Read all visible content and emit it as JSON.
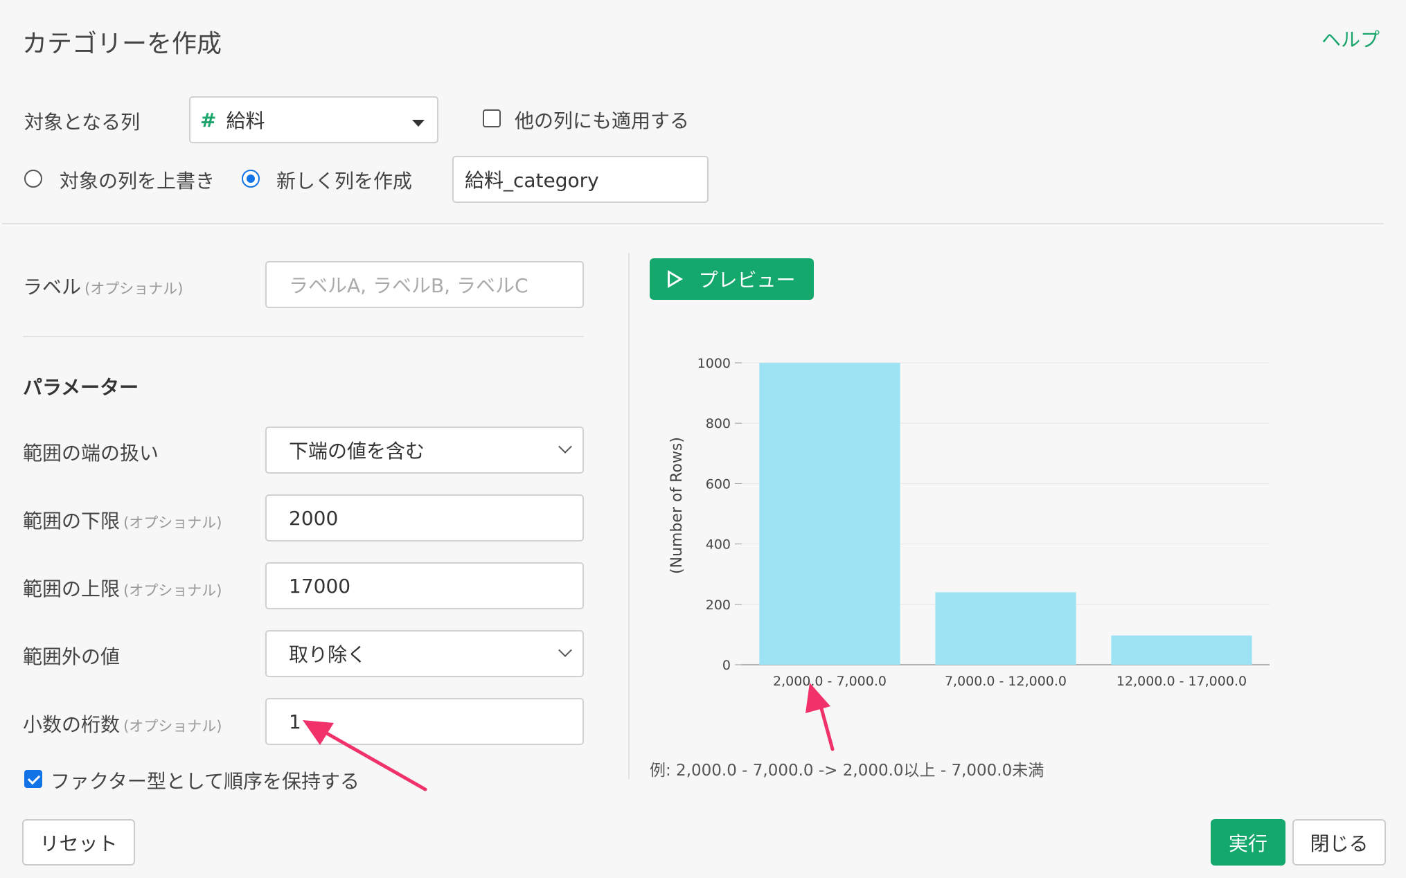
{
  "header": {
    "title": "カテゴリーを作成",
    "help_label": "ヘルプ"
  },
  "target": {
    "label": "対象となる列",
    "column": "給料",
    "column_type_icon": "#",
    "apply_others_label": "他の列にも適用する",
    "apply_others_checked": false
  },
  "mode": {
    "overwrite_label": "対象の列を上書き",
    "new_label": "新しく列を作成",
    "selected": "new",
    "new_column_name": "給料_category"
  },
  "label_field": {
    "label": "ラベル",
    "optional": "(オプショナル)",
    "placeholder": "ラベルA, ラベルB, ラベルC"
  },
  "params": {
    "heading": "パラメーター",
    "edge": {
      "label": "範囲の端の扱い",
      "value": "下端の値を含む"
    },
    "lower": {
      "label": "範囲の下限",
      "optional": "(オプショナル)",
      "value": "2000"
    },
    "upper": {
      "label": "範囲の上限",
      "optional": "(オプショナル)",
      "value": "17000"
    },
    "outside": {
      "label": "範囲外の値",
      "value": "取り除く"
    },
    "digits": {
      "label": "小数の桁数",
      "optional": "(オプショナル)",
      "value": "1"
    },
    "factor": {
      "label": "ファクター型として順序を保持する",
      "checked": true
    }
  },
  "preview_label": "プレビュー",
  "chart_data": {
    "type": "bar",
    "categories": [
      "2,000.0 - 7,000.0",
      "7,000.0 - 12,000.0",
      "12,000.0 - 17,000.0"
    ],
    "values": [
      1000,
      240,
      97
    ],
    "ylabel": "(Number of Rows)",
    "xlabel": "",
    "ylim": [
      0,
      1000
    ],
    "yticks": [
      0,
      200,
      400,
      600,
      800,
      1000
    ],
    "grid": true,
    "bar_color": "#9de3f4"
  },
  "example_note": "例: 2,000.0 - 7,000.0 -> 2,000.0以上 - 7,000.0未満",
  "footer": {
    "reset": "リセット",
    "run": "実行",
    "close": "閉じる"
  },
  "colors": {
    "accent": "#14a86c",
    "radio_checkbox": "#1173e6",
    "annotation_arrow": "#f0316a"
  }
}
